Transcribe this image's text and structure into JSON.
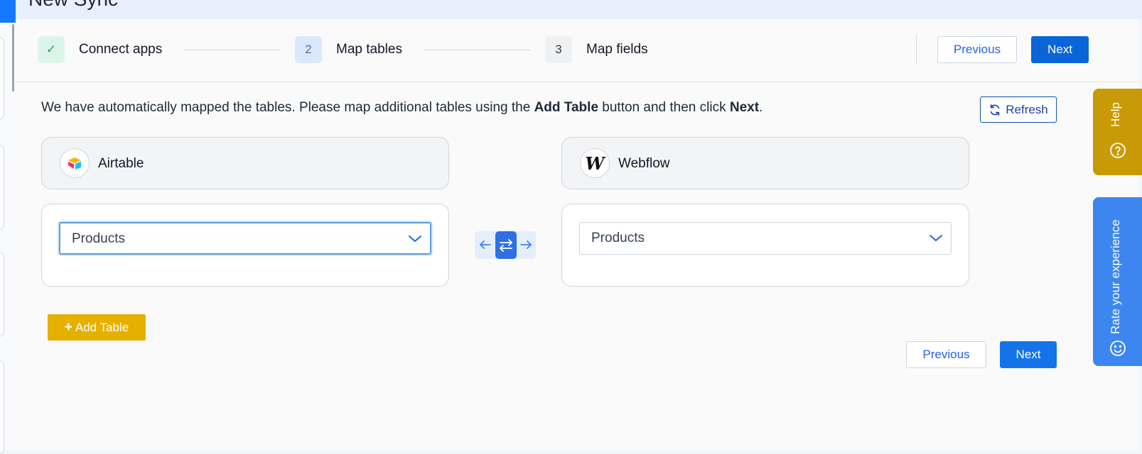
{
  "header": {
    "title": "New Sync"
  },
  "stepper": {
    "steps": [
      {
        "badge": "✓",
        "label": "Connect apps",
        "state": "complete"
      },
      {
        "badge": "2",
        "label": "Map tables",
        "state": "active"
      },
      {
        "badge": "3",
        "label": "Map fields",
        "state": "upcoming"
      }
    ],
    "previous_label": "Previous",
    "next_label": "Next"
  },
  "instruction": {
    "part1": "We have automatically mapped the tables. Please map additional tables using the ",
    "bold1": "Add Table",
    "part2": " button and then click ",
    "bold2": "Next",
    "part3": "."
  },
  "refresh_label": "Refresh",
  "source_app": {
    "name": "Airtable",
    "selected_table": "Products",
    "icon": "airtable-logo-icon"
  },
  "target_app": {
    "name": "Webflow",
    "logo_letter": "W",
    "selected_table": "Products",
    "icon": "webflow-logo-icon"
  },
  "direction": {
    "mode": "two-way"
  },
  "add_table_label": "Add Table",
  "footer": {
    "previous_label": "Previous",
    "next_label": "Next"
  },
  "side_tabs": {
    "help_label": "Help",
    "rate_label": "Rate your experience"
  },
  "colors": {
    "primary": "#0a66d8",
    "accent_yellow": "#e6b000",
    "help_tab": "#c89a06",
    "rate_tab": "#3d86f0",
    "success_green": "#22a06b"
  }
}
